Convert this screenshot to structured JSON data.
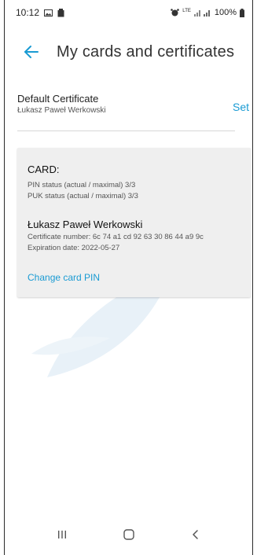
{
  "status_bar": {
    "time": "10:12",
    "lte_label": "LTE",
    "battery": "100%"
  },
  "app_bar": {
    "title": "My cards and certificates",
    "back_icon": "back-arrow-icon",
    "accent": "#1a9bd3"
  },
  "default_certificate": {
    "label": "Default Certificate",
    "name": "Łukasz Paweł Werkowski",
    "action": "Set"
  },
  "card": {
    "title": "CARD:",
    "pin_status": "PIN status (actual / maximal) 3/3",
    "puk_status": "PUK status (actual / maximal) 3/3",
    "holder": "Łukasz Paweł Werkowski",
    "certificate_number": "Certificate number: 6c 74 a1 cd 92 63 30 86 44 a9 9c",
    "expiration": "Expiration date: 2022-05-27",
    "action": "Change card PIN"
  },
  "nav_bar": {
    "recents_icon": "recents-icon",
    "home_icon": "home-icon",
    "back_icon": "nav-back-icon"
  }
}
